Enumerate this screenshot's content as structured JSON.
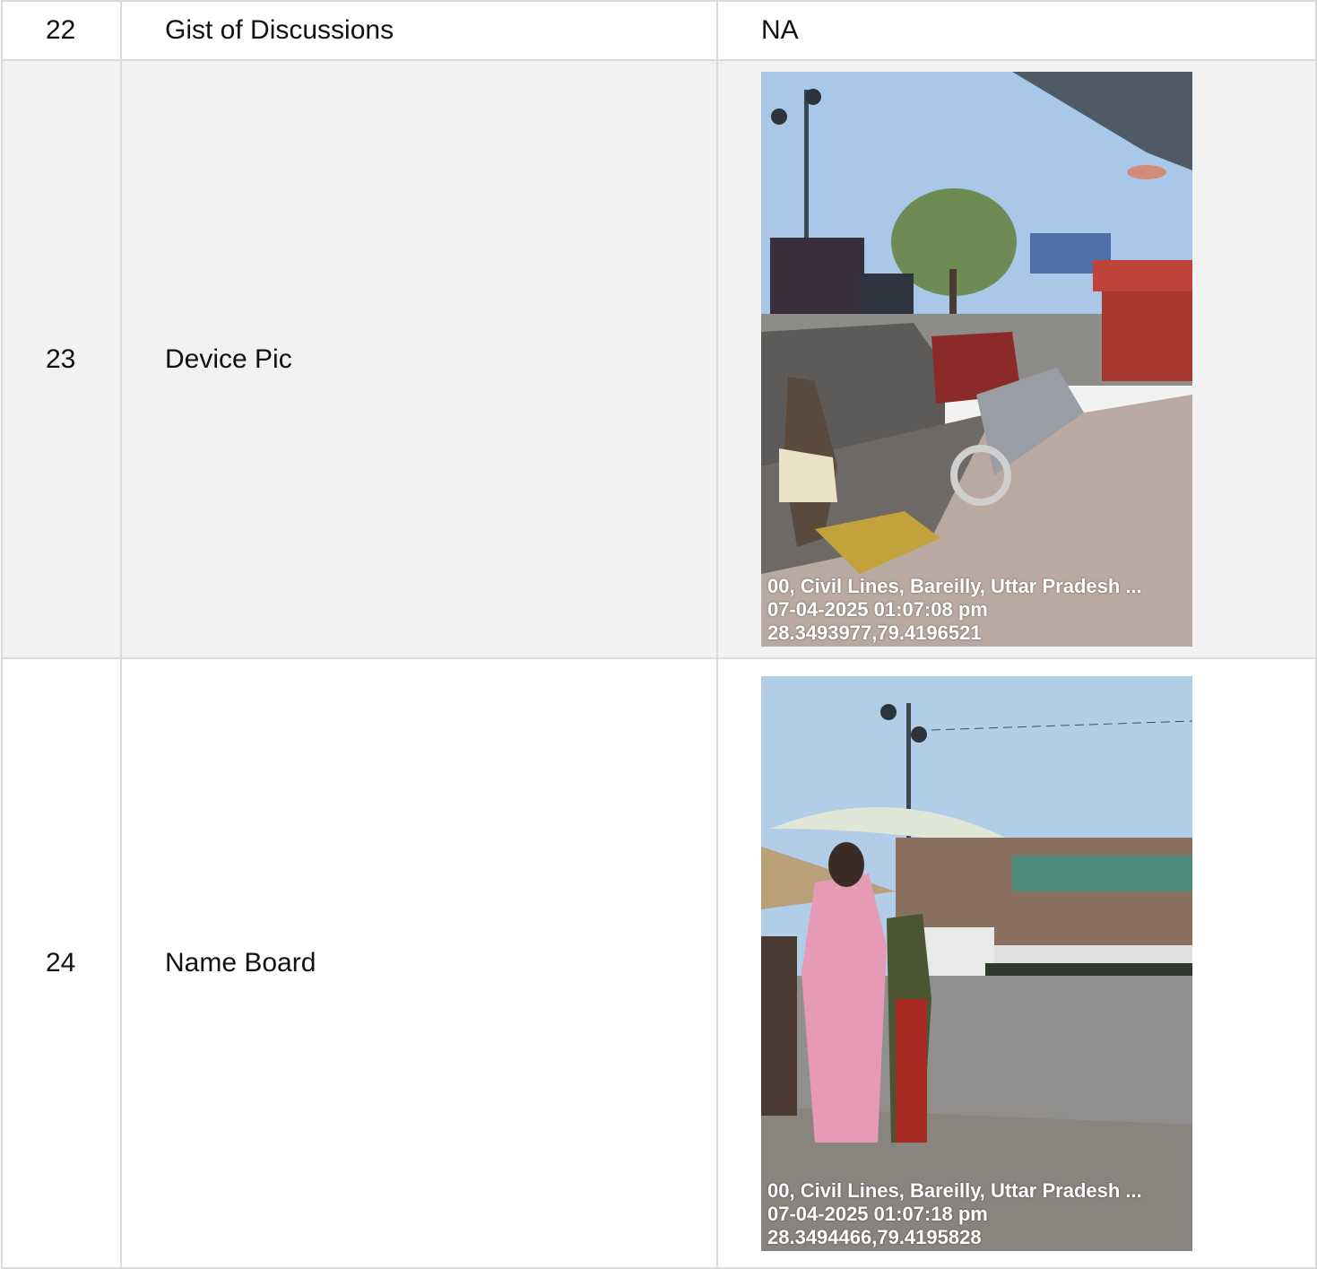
{
  "rows": [
    {
      "no": "22",
      "label": "Gist of Discussions",
      "value": "NA"
    },
    {
      "no": "23",
      "label": "Device Pic",
      "photo": {
        "address": "00, Civil Lines, Bareilly, Uttar Pradesh ...",
        "datetime": "07-04-2025 01:07:08 pm",
        "coords": "28.3493977,79.4196521"
      }
    },
    {
      "no": "24",
      "label": "Name Board",
      "photo": {
        "address": "00, Civil Lines, Bareilly, Uttar Pradesh ...",
        "datetime": "07-04-2025 01:07:18 pm",
        "coords": "28.3494466,79.4195828"
      }
    }
  ],
  "colors": {
    "border": "#dadada",
    "shaded_row": "#f2f2f2",
    "sky": "#a9c8e8",
    "pavement": "#b9a9a0"
  }
}
